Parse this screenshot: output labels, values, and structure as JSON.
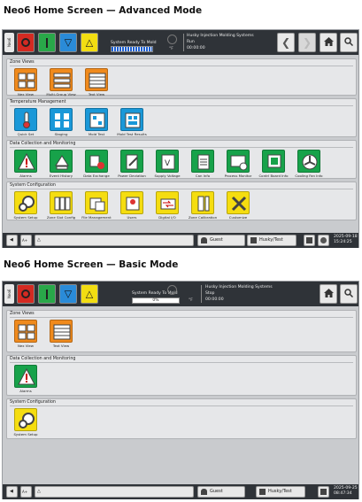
{
  "adv": {
    "heading": "Neo6 Home Screen — Advanced Mode",
    "brand": "Neo6",
    "status": "System Ready To Mold",
    "unit": "°F",
    "machine": "Husky Injection Molding Systems",
    "state": "Run",
    "timer": "00:00:00",
    "progress": 1.0,
    "sections": {
      "zone": {
        "title": "Zone Views",
        "items": [
          "Nex View",
          "Multi-Group View",
          "Text View"
        ]
      },
      "temp": {
        "title": "Temperature Management",
        "items": [
          "Quick Set",
          "Staging",
          "Mold Test",
          "Mold Test Results"
        ]
      },
      "data": {
        "title": "Data Collection and Monitoring",
        "items": [
          "Alarms",
          "Event History",
          "Data Exchange",
          "Power Deviation",
          "Supply Voltage",
          "Can Info",
          "Process Monitor",
          "Contrl Board Info",
          "Cooling Fan Info"
        ]
      },
      "sys": {
        "title": "System Configuration",
        "items": [
          "System Setup",
          "Zone Slot Config",
          "File Management",
          "Users",
          "Digital I/O",
          "Zone Calibration",
          "Customize"
        ]
      }
    },
    "bottom": {
      "user": "Guest",
      "mold": "Husky/Test",
      "date": "2025-09-18",
      "time": "15:24:25"
    }
  },
  "basic": {
    "heading": "Neo6 Home Screen — Basic Mode",
    "brand": "Neo6",
    "status": "System Ready To Mold",
    "pct": "0%",
    "progress": 0.0,
    "unit": "°F",
    "machine": "Husky Injection Molding Systems",
    "state": "Stop",
    "timer": "00:00:00",
    "sections": {
      "zone": {
        "title": "Zone Views",
        "items": [
          "Nex View",
          "Text View"
        ]
      },
      "data": {
        "title": "Data Collection and Monitoring",
        "items": [
          "Alarms"
        ]
      },
      "sys": {
        "title": "System Configuration",
        "items": [
          "System Setup"
        ]
      }
    },
    "bottom": {
      "user": "Guest",
      "mold": "Husky/Test",
      "date": "2025-09-25",
      "time": "08:47:34"
    }
  },
  "colors": {
    "red": "#d42a22",
    "green": "#29a849",
    "blue": "#2a8bd8",
    "yellow": "#f2dd12",
    "orange": "#f08a1c",
    "tile_blue": "#1a98d8",
    "tile_green": "#17a24a",
    "bar": "#2f3338"
  }
}
